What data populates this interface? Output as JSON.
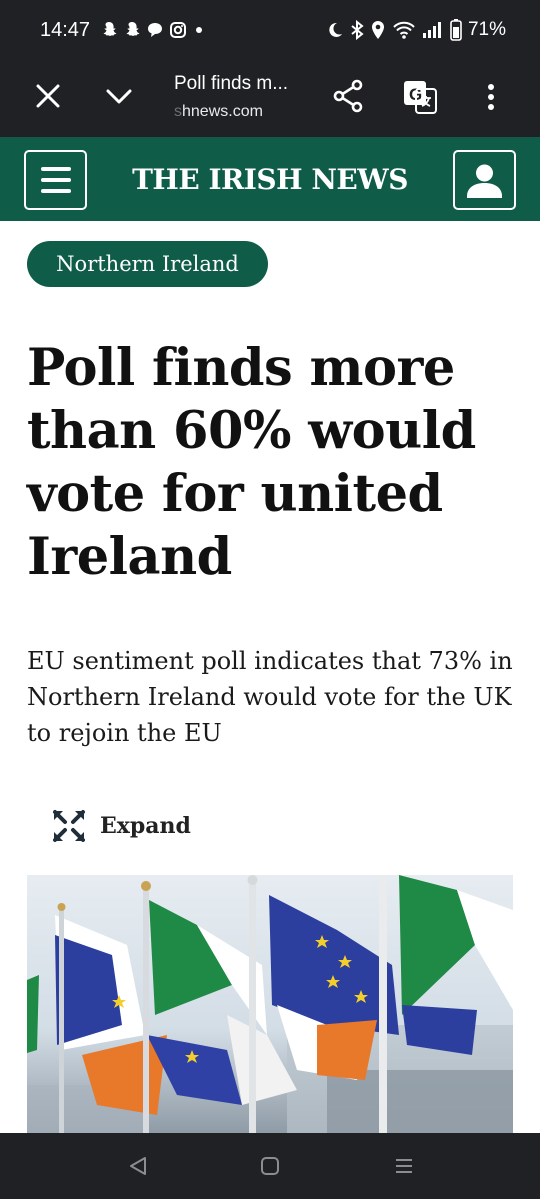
{
  "status_bar": {
    "time": "14:47",
    "battery": "71%",
    "left_icons": [
      "snapchat-icon",
      "snapchat-icon",
      "chat-bubble-icon",
      "instagram-icon",
      "dot-icon"
    ],
    "right_icons": [
      "moon-icon",
      "bluetooth-icon",
      "location-icon",
      "wifi-icon",
      "signal-icon",
      "battery-icon"
    ]
  },
  "browser": {
    "page_title": "Poll finds m...",
    "url_faded": "s",
    "url": "hnews.com"
  },
  "site": {
    "name": "THE IRISH NEWS",
    "brand_color": "#0f5c48"
  },
  "article": {
    "category": "Northern Ireland",
    "headline": "Poll finds more than 60% would vote for united Ireland",
    "standfirst": "EU sentiment poll indicates that 73% in Northern Ireland would vote for the UK to rejoin the EU",
    "expand_label": "Expand"
  }
}
